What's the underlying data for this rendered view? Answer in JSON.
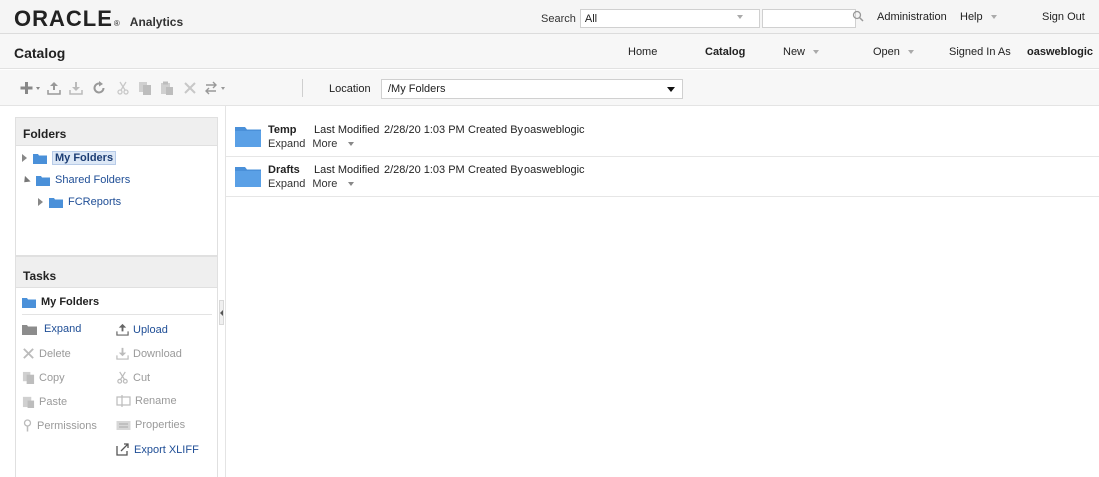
{
  "brand": {
    "logo": "ORACLE",
    "product": "Analytics"
  },
  "search": {
    "label": "Search",
    "scope": "All",
    "value": ""
  },
  "top_nav": {
    "administration": "Administration",
    "help": "Help",
    "sign_out": "Sign Out"
  },
  "header": {
    "title": "Catalog",
    "home": "Home",
    "catalog": "Catalog",
    "new": "New",
    "open": "Open",
    "signed_in_as_label": "Signed In As",
    "username": "oasweblogic"
  },
  "toolbar": {
    "location_label": "Location",
    "location_value": "/My Folders"
  },
  "folders_panel": {
    "title": "Folders",
    "items": [
      {
        "label": "My Folders",
        "selected": true
      },
      {
        "label": "Shared Folders"
      },
      {
        "label": "FCReports"
      }
    ]
  },
  "tasks_panel": {
    "title": "Tasks",
    "context": "My Folders",
    "tasks": [
      {
        "label": "Expand",
        "enabled": true,
        "icon": "folder-open-icon"
      },
      {
        "label": "Upload",
        "enabled": true,
        "icon": "upload-icon"
      },
      {
        "label": "Delete",
        "enabled": false,
        "icon": "delete-icon"
      },
      {
        "label": "Download",
        "enabled": false,
        "icon": "download-icon"
      },
      {
        "label": "Copy",
        "enabled": false,
        "icon": "copy-icon"
      },
      {
        "label": "Cut",
        "enabled": false,
        "icon": "cut-icon"
      },
      {
        "label": "Paste",
        "enabled": false,
        "icon": "paste-icon"
      },
      {
        "label": "Rename",
        "enabled": false,
        "icon": "rename-icon"
      },
      {
        "label": "Permissions",
        "enabled": false,
        "icon": "permissions-icon"
      },
      {
        "label": "Properties",
        "enabled": false,
        "icon": "properties-icon"
      },
      {
        "label": "Export XLIFF",
        "enabled": true,
        "icon": "export-icon"
      }
    ]
  },
  "catalog_items": [
    {
      "name": "Temp",
      "modified_label": "Last Modified",
      "modified": "2/28/20 1:03 PM",
      "created_label": "Created By",
      "created_by": "oasweblogic",
      "expand": "Expand",
      "more": "More"
    },
    {
      "name": "Drafts",
      "modified_label": "Last Modified",
      "modified": "2/28/20 1:03 PM",
      "created_label": "Created By",
      "created_by": "oasweblogic",
      "expand": "Expand",
      "more": "More"
    }
  ],
  "colors": {
    "link": "#1f4e96",
    "folder": "#4a90d9",
    "disabled": "#9a9a9a"
  }
}
